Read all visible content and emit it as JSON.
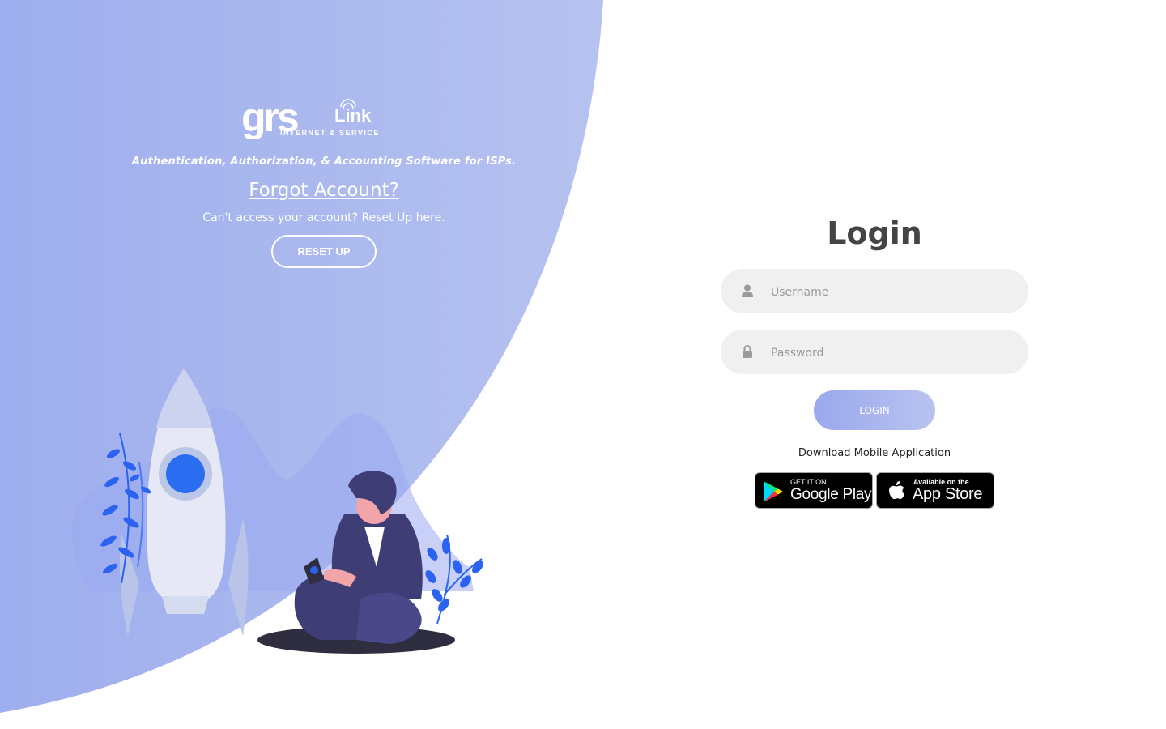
{
  "colors": {
    "panel_blue": "#a4b2ee",
    "accent_blue": "#2563eb",
    "login_gradient_start": "#9aa8ee",
    "login_gradient_end": "#b9c3ef",
    "field_bg": "#f0f0f0"
  },
  "left": {
    "logo_text": "grs Link INTERNET & SERVICE",
    "tagline": "Authentication, Authorization, & Accounting Software for ISPs.",
    "forgot_title": "Forgot Account?",
    "forgot_subtitle": "Can't access your account? Reset Up here.",
    "reset_button": "RESET UP"
  },
  "login": {
    "title": "Login",
    "username_placeholder": "Username",
    "username_icon": "user-icon",
    "password_placeholder": "Password",
    "password_icon": "lock-icon",
    "submit_label": "LOGIN",
    "download_text": "Download Mobile Application"
  },
  "stores": {
    "google_small": "GET IT ON",
    "google_big": "Google Play",
    "apple_small": "Available on the",
    "apple_big": "App Store"
  }
}
